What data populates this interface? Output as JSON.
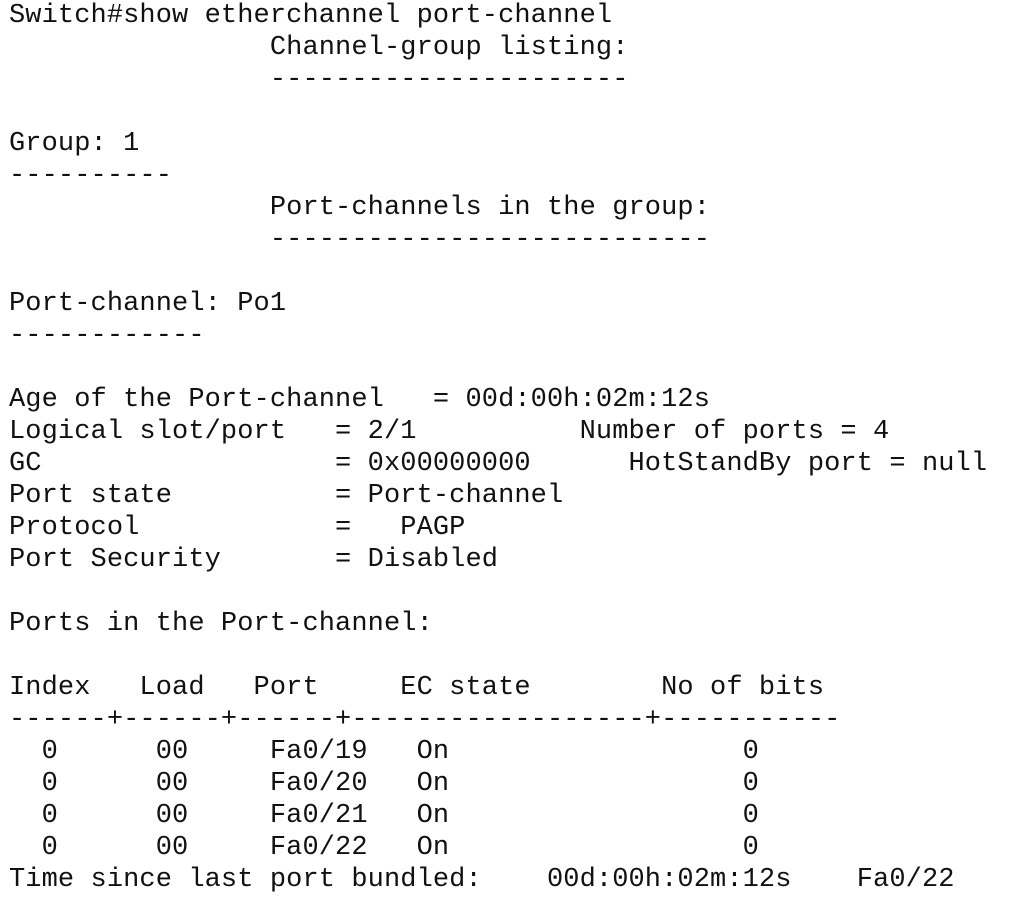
{
  "terminal": {
    "lines": [
      "Switch#show etherchannel port-channel",
      "                Channel-group listing:",
      "                ----------------------",
      "",
      "Group: 1",
      "----------",
      "                Port-channels in the group:",
      "                ---------------------------",
      "",
      "Port-channel: Po1",
      "------------",
      "",
      "Age of the Port-channel   = 00d:00h:02m:12s",
      "Logical slot/port   = 2/1          Number of ports = 4",
      "GC                  = 0x00000000      HotStandBy port = null",
      "Port state          = Port-channel",
      "Protocol            =   PAGP",
      "Port Security       = Disabled",
      "",
      "Ports in the Port-channel:",
      "",
      "Index   Load   Port     EC state        No of bits",
      "------+------+------+------------------+-----------",
      "  0      00     Fa0/19   On                  0",
      "  0      00     Fa0/20   On                  0",
      "  0      00     Fa0/21   On                  0",
      "  0      00     Fa0/22   On                  0",
      "Time since last port bundled:    00d:00h:02m:12s    Fa0/22"
    ]
  }
}
